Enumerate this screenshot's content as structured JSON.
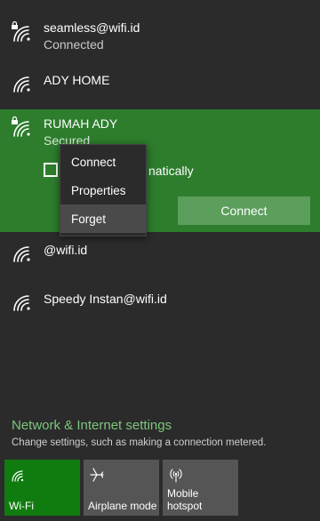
{
  "networks": [
    {
      "ssid": "seamless@wifi.id",
      "status": "Connected",
      "secured": true
    },
    {
      "ssid": "ADY HOME",
      "status": "",
      "secured": false
    },
    {
      "ssid": "RUMAH ADY",
      "status": "Secured",
      "secured": true
    },
    {
      "ssid": "@wifi.id",
      "status": "",
      "secured": false
    },
    {
      "ssid": "Speedy Instan@wifi.id",
      "status": "",
      "secured": false
    }
  ],
  "selected_network": {
    "auto_connect_label": "Connect automatically",
    "auto_connect_visible_text": "natically",
    "auto_connect_checked": false,
    "connect_button": "Connect"
  },
  "context_menu": {
    "items": [
      "Connect",
      "Properties",
      "Forget"
    ],
    "hovered": "Forget"
  },
  "settings": {
    "link": "Network & Internet settings",
    "description": "Change settings, such as making a connection metered."
  },
  "quick_actions": [
    {
      "label": "Wi-Fi",
      "icon": "wifi-icon",
      "active": true
    },
    {
      "label": "Airplane mode",
      "icon": "airplane-icon",
      "active": false
    },
    {
      "label": "Mobile hotspot",
      "icon": "hotspot-icon",
      "active": false
    }
  ],
  "colors": {
    "background": "#2b2b2b",
    "accent": "#107c10",
    "selected_row": "#2d7d2d",
    "link": "#7dc67d",
    "tile": "#555555"
  }
}
